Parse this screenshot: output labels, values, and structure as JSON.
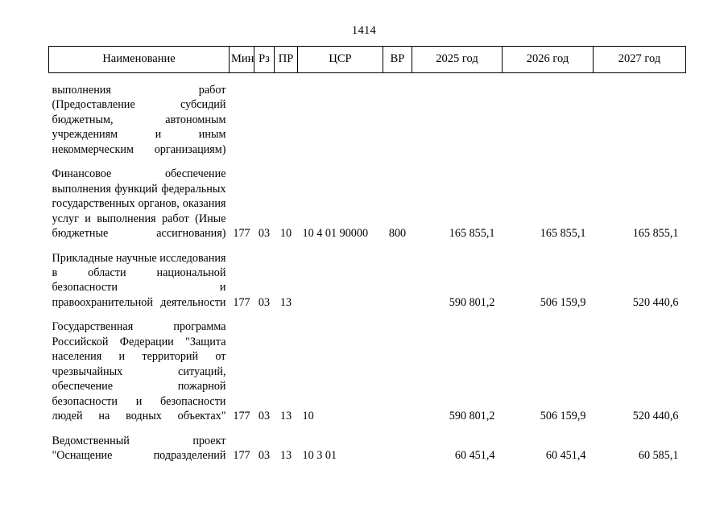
{
  "page": {
    "number": "1414"
  },
  "table": {
    "headers": [
      {
        "key": "name",
        "label": "Наименование"
      },
      {
        "key": "min",
        "label": "Мин"
      },
      {
        "key": "rz",
        "label": "Рз"
      },
      {
        "key": "pr",
        "label": "ПР"
      },
      {
        "key": "csr",
        "label": "ЦСР"
      },
      {
        "key": "vr",
        "label": "ВР"
      },
      {
        "key": "y2025",
        "label": "2025 год"
      },
      {
        "key": "y2026",
        "label": "2026 год"
      },
      {
        "key": "y2027",
        "label": "2027 год"
      }
    ],
    "rows": [
      {
        "name": "выполнения работ (Предоставление субсидий бюджетным, автономным учреждениям и иным некоммерческим",
        "name_last": "организациям)",
        "min": "",
        "rz": "",
        "pr": "",
        "csr": "",
        "vr": "",
        "y2025": "",
        "y2026": "",
        "y2027": ""
      },
      {
        "name": "Финансовое обеспечение выполнения функций федеральных государственных органов, оказания услуг и выполнения работ (Иные",
        "name_last": "бюджетные ассигнования)",
        "min": "177",
        "rz": "03",
        "pr": "10",
        "csr": "10 4 01 90000",
        "vr": "800",
        "y2025": "165 855,1",
        "y2026": "165 855,1",
        "y2027": "165 855,1"
      },
      {
        "name": "Прикладные научные исследования в области национальной безопасности и правоохранительной",
        "name_last": "деятельности",
        "min": "177",
        "rz": "03",
        "pr": "13",
        "csr": "",
        "vr": "",
        "y2025": "590 801,2",
        "y2026": "506 159,9",
        "y2027": "520 440,6"
      },
      {
        "name": "Государственная программа Российской Федерации \"Защита населения и территорий от чрезвычайных ситуаций, обеспечение пожарной безопасности и безопасности людей на водных",
        "name_last": "объектах\"",
        "min": "177",
        "rz": "03",
        "pr": "13",
        "csr": "10",
        "vr": "",
        "y2025": "590 801,2",
        "y2026": "506 159,9",
        "y2027": "520 440,6"
      },
      {
        "name": "Ведомственный проект",
        "name_last": "\"Оснащение подразделений",
        "min": "177",
        "rz": "03",
        "pr": "13",
        "csr": "10 3 01",
        "vr": "",
        "y2025": "60 451,4",
        "y2026": "60 451,4",
        "y2027": "60 585,1"
      }
    ]
  }
}
